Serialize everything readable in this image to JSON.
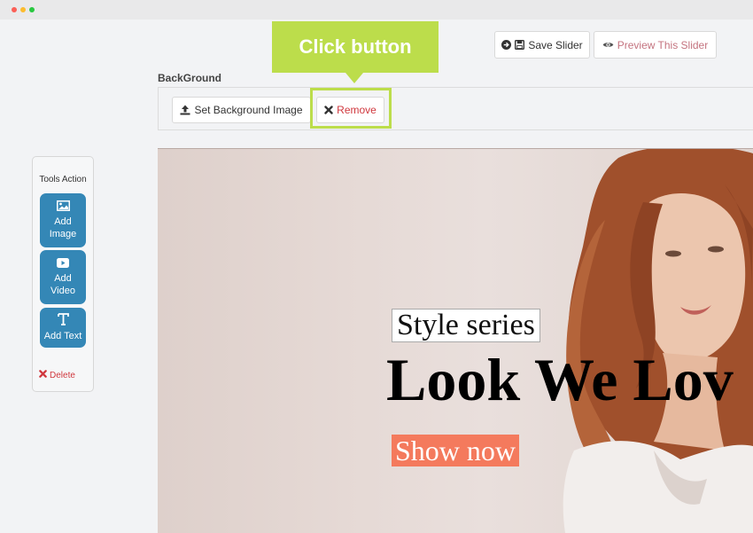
{
  "window": {
    "controls": [
      "close",
      "minimize",
      "maximize"
    ]
  },
  "toolbar": {
    "save_label": "Save Slider",
    "save_icons": [
      "circle-arrow-icon",
      "floppy-icon"
    ],
    "preview_label": "Preview This Slider",
    "preview_icon": "eye-icon",
    "preview_color": "#c4737f"
  },
  "callout": {
    "text": "Click button",
    "color": "#bcdd4b"
  },
  "background": {
    "label": "BackGround",
    "set_label": "Set Background Image",
    "set_icon": "upload-icon",
    "remove_label": "Remove",
    "remove_icon": "close-icon",
    "remove_color": "#d0383e"
  },
  "tools": {
    "title": "Tools Action",
    "add_image": "Add Image",
    "add_video": "Add Video",
    "add_text": "Add Text",
    "delete": "Delete",
    "accent": "#3487b6"
  },
  "slide": {
    "subtitle": "Style series",
    "headline": "Look We Lov",
    "cta": "Show now",
    "cta_color": "#f47a5d"
  }
}
